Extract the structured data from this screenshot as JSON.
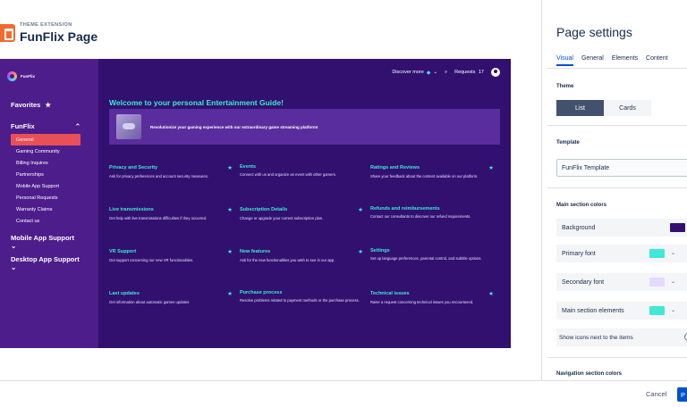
{
  "header": {
    "kicker": "THEME EXTENSION",
    "title": "FunFlix Page"
  },
  "preview": {
    "brand": "FunFlix",
    "nav": {
      "favorites": "Favorites",
      "sections": [
        {
          "label": "FunFlix",
          "expanded": true,
          "items": [
            {
              "label": "General",
              "active": true
            },
            {
              "label": "Gaming Community"
            },
            {
              "label": "Billing Inquires"
            },
            {
              "label": "Partnerships"
            },
            {
              "label": "Mobile App Support"
            },
            {
              "label": "Personal Requests"
            },
            {
              "label": "Warranty Claims"
            },
            {
              "label": "Contact us"
            }
          ]
        },
        {
          "label": "Mobile App Support",
          "expanded": false
        },
        {
          "label": "Desktop App Support",
          "expanded": false
        }
      ]
    },
    "topbar": {
      "discover": "Discover more",
      "requests": "Requests",
      "requests_count": "17"
    },
    "welcome": "Welcome to your personal Entertainment Guide!",
    "banner_text": "Revolutionize your gaming experience with our extraordinary game streaming platform!",
    "cards": [
      {
        "title": "Privacy and Security",
        "desc": "Ask for privacy preferences and account security measures.",
        "starred": true
      },
      {
        "title": "Events",
        "desc": "Connect with us and organize an event with other gamers.",
        "starred": false
      },
      {
        "title": "Ratings and Reviews",
        "desc": "Share your feedback about the content available on our platform.",
        "starred": true
      },
      {
        "title": "Live transmissions",
        "desc": "Get help with live transmissions difficulties if they occurred.",
        "starred": true
      },
      {
        "title": "Subscription Details",
        "desc": "Change or upgrade your current subscription plan.",
        "starred": true
      },
      {
        "title": "Refunds and reimbursements",
        "desc": "Contact our consultants to discover our refund requirements.",
        "starred": false
      },
      {
        "title": "VR Support",
        "desc": "Get support concerning our new VR functionalities.",
        "starred": true
      },
      {
        "title": "New features",
        "desc": "Ask for the new functionalities you wish to see in our app.",
        "starred": true
      },
      {
        "title": "Settings",
        "desc": "Set up language preferences, parental control, and subtitle options.",
        "starred": false
      },
      {
        "title": "Last updates",
        "desc": "Get information about automatic games updates",
        "starred": true
      },
      {
        "title": "Purchase process",
        "desc": "Resolve problems related to payment methods or the purchase process.",
        "starred": false
      },
      {
        "title": "Technical issues",
        "desc": "Raise a request concerning technical issues you encountered.",
        "starred": true
      }
    ]
  },
  "settings": {
    "title": "Page settings",
    "tabs": [
      "Visual",
      "General",
      "Elements",
      "Content"
    ],
    "active_tab": "Visual",
    "theme_label": "Theme",
    "theme_options": [
      "List",
      "Cards"
    ],
    "theme_selected": "List",
    "template_label": "Template",
    "template_value": "FunFlix Template",
    "main_colors_label": "Main section colors",
    "colors": [
      {
        "label": "Background",
        "color": "#31106f"
      },
      {
        "label": "Primary font",
        "color": "#3fe8d7"
      },
      {
        "label": "Secondary font",
        "color": "#e4d9ff"
      },
      {
        "label": "Main section elements",
        "color": "#3fe8d7"
      }
    ],
    "toggle_label": "Show icons next to the items",
    "nav_colors_label": "Navigation section colors"
  },
  "footer": {
    "cancel": "Cancel",
    "primary": "P"
  },
  "icons": {
    "star": "star-icon",
    "chevron": "chevron-down-icon",
    "search": "search-icon",
    "gem": "gem-icon"
  }
}
